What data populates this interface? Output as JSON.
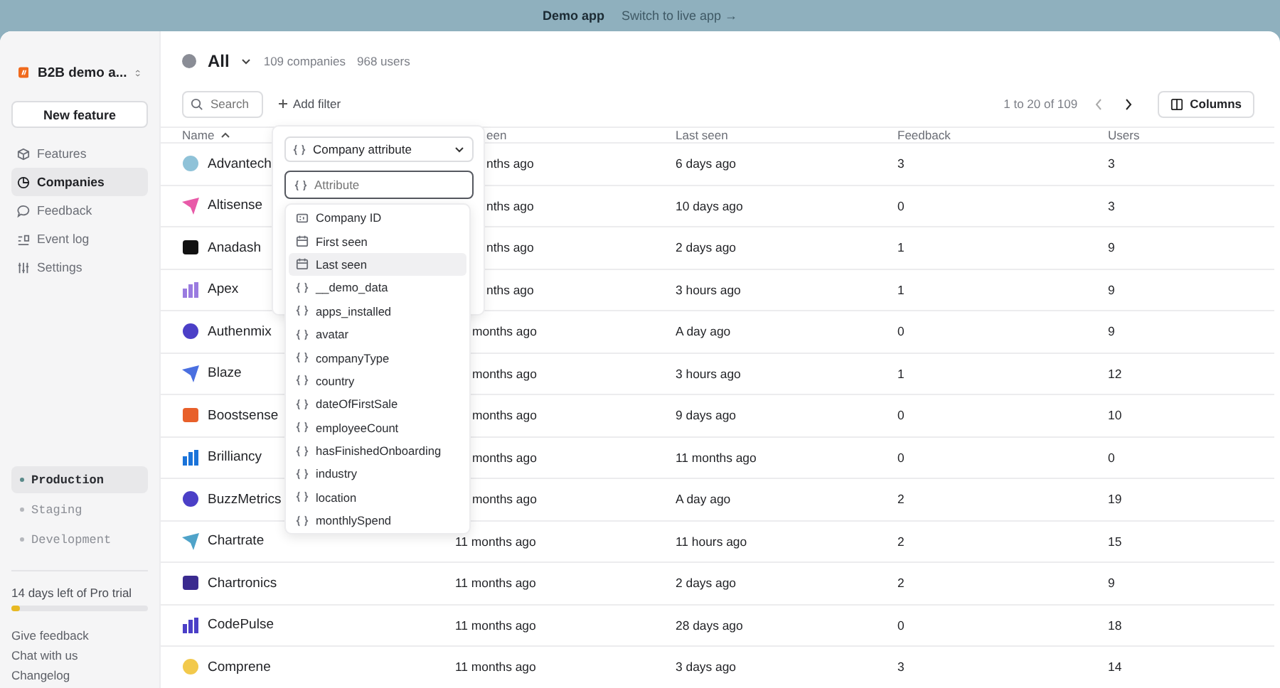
{
  "banner": {
    "title": "Demo app",
    "link": "Switch to live app →"
  },
  "sidebar": {
    "workspace": "B2B demo a...",
    "new_button": "New feature",
    "nav": [
      {
        "label": "Features",
        "selected": false
      },
      {
        "label": "Companies",
        "selected": true
      },
      {
        "label": "Feedback",
        "selected": false
      },
      {
        "label": "Event log",
        "selected": false
      },
      {
        "label": "Settings",
        "selected": false
      }
    ],
    "environments": [
      {
        "label": "Production",
        "selected": true
      },
      {
        "label": "Staging",
        "selected": false
      },
      {
        "label": "Development",
        "selected": false
      }
    ],
    "trial": {
      "text": "14 days left of Pro trial",
      "level": 0.06
    },
    "links": [
      "Give feedback",
      "Chat with us",
      "Changelog"
    ]
  },
  "header": {
    "segment": "All",
    "companies": "109 companies",
    "users": "968 users"
  },
  "toolbar": {
    "search_placeholder": "Search",
    "add_filter": "Add filter",
    "pagination": "1 to 20 of 109",
    "columns_button": "Columns"
  },
  "table": {
    "columns": [
      {
        "label": "Name",
        "sorted": true
      },
      {
        "label": "een",
        "sorted": false
      },
      {
        "label": "Last seen",
        "sorted": false
      },
      {
        "label": "Feedback",
        "sorted": false
      },
      {
        "label": "Users",
        "sorted": false
      }
    ],
    "rows": [
      {
        "name": "Advantech",
        "first_seen": "nths ago",
        "last_seen": "6 days ago",
        "feedback": "3",
        "users": "3"
      },
      {
        "name": "Altisense",
        "first_seen": "nths ago",
        "last_seen": "10 days ago",
        "feedback": "0",
        "users": "3"
      },
      {
        "name": "Anadash",
        "first_seen": "nths ago",
        "last_seen": "2 days ago",
        "feedback": "1",
        "users": "9"
      },
      {
        "name": "Apex",
        "first_seen": "nths ago",
        "last_seen": "3 hours ago",
        "feedback": "1",
        "users": "9"
      },
      {
        "name": "Authenmix",
        "first_seen": "months ago",
        "last_seen": "A day ago",
        "feedback": "0",
        "users": "9"
      },
      {
        "name": "Blaze",
        "first_seen": "months ago",
        "last_seen": "3 hours ago",
        "feedback": "1",
        "users": "12"
      },
      {
        "name": "Boostsense",
        "first_seen": "months ago",
        "last_seen": "9 days ago",
        "feedback": "0",
        "users": "10"
      },
      {
        "name": "Brilliancy",
        "first_seen": "months ago",
        "last_seen": "11 months ago",
        "feedback": "0",
        "users": "0"
      },
      {
        "name": "BuzzMetrics",
        "first_seen": "months ago",
        "last_seen": "A day ago",
        "feedback": "2",
        "users": "19"
      },
      {
        "name": "Chartrate",
        "first_seen": "11 months ago",
        "last_seen": "11 hours ago",
        "feedback": "2",
        "users": "15"
      },
      {
        "name": "Chartronics",
        "first_seen": "11 months ago",
        "last_seen": "2 days ago",
        "feedback": "2",
        "users": "9"
      },
      {
        "name": "CodePulse",
        "first_seen": "11 months ago",
        "last_seen": "28 days ago",
        "feedback": "0",
        "users": "18"
      },
      {
        "name": "Comprene",
        "first_seen": "11 months ago",
        "last_seen": "3 days ago",
        "feedback": "3",
        "users": "14"
      }
    ]
  },
  "filter_popover": {
    "select": "Company attribute",
    "input_placeholder": "Attribute",
    "options": [
      {
        "label": "Company ID",
        "kind": "id",
        "selected": false
      },
      {
        "label": "First seen",
        "kind": "date",
        "selected": false
      },
      {
        "label": "Last seen",
        "kind": "date",
        "selected": true
      },
      {
        "label": "__demo_data",
        "kind": "attr",
        "selected": false
      },
      {
        "label": "apps_installed",
        "kind": "attr",
        "selected": false
      },
      {
        "label": "avatar",
        "kind": "attr",
        "selected": false
      },
      {
        "label": "companyType",
        "kind": "attr",
        "selected": false
      },
      {
        "label": "country",
        "kind": "attr",
        "selected": false
      },
      {
        "label": "dateOfFirstSale",
        "kind": "attr",
        "selected": false
      },
      {
        "label": "employeeCount",
        "kind": "attr",
        "selected": false
      },
      {
        "label": "hasFinishedOnboarding",
        "kind": "attr",
        "selected": false
      },
      {
        "label": "industry",
        "kind": "attr",
        "selected": false
      },
      {
        "label": "location",
        "kind": "attr",
        "selected": false
      },
      {
        "label": "monthlySpend",
        "kind": "attr",
        "selected": false
      }
    ]
  }
}
